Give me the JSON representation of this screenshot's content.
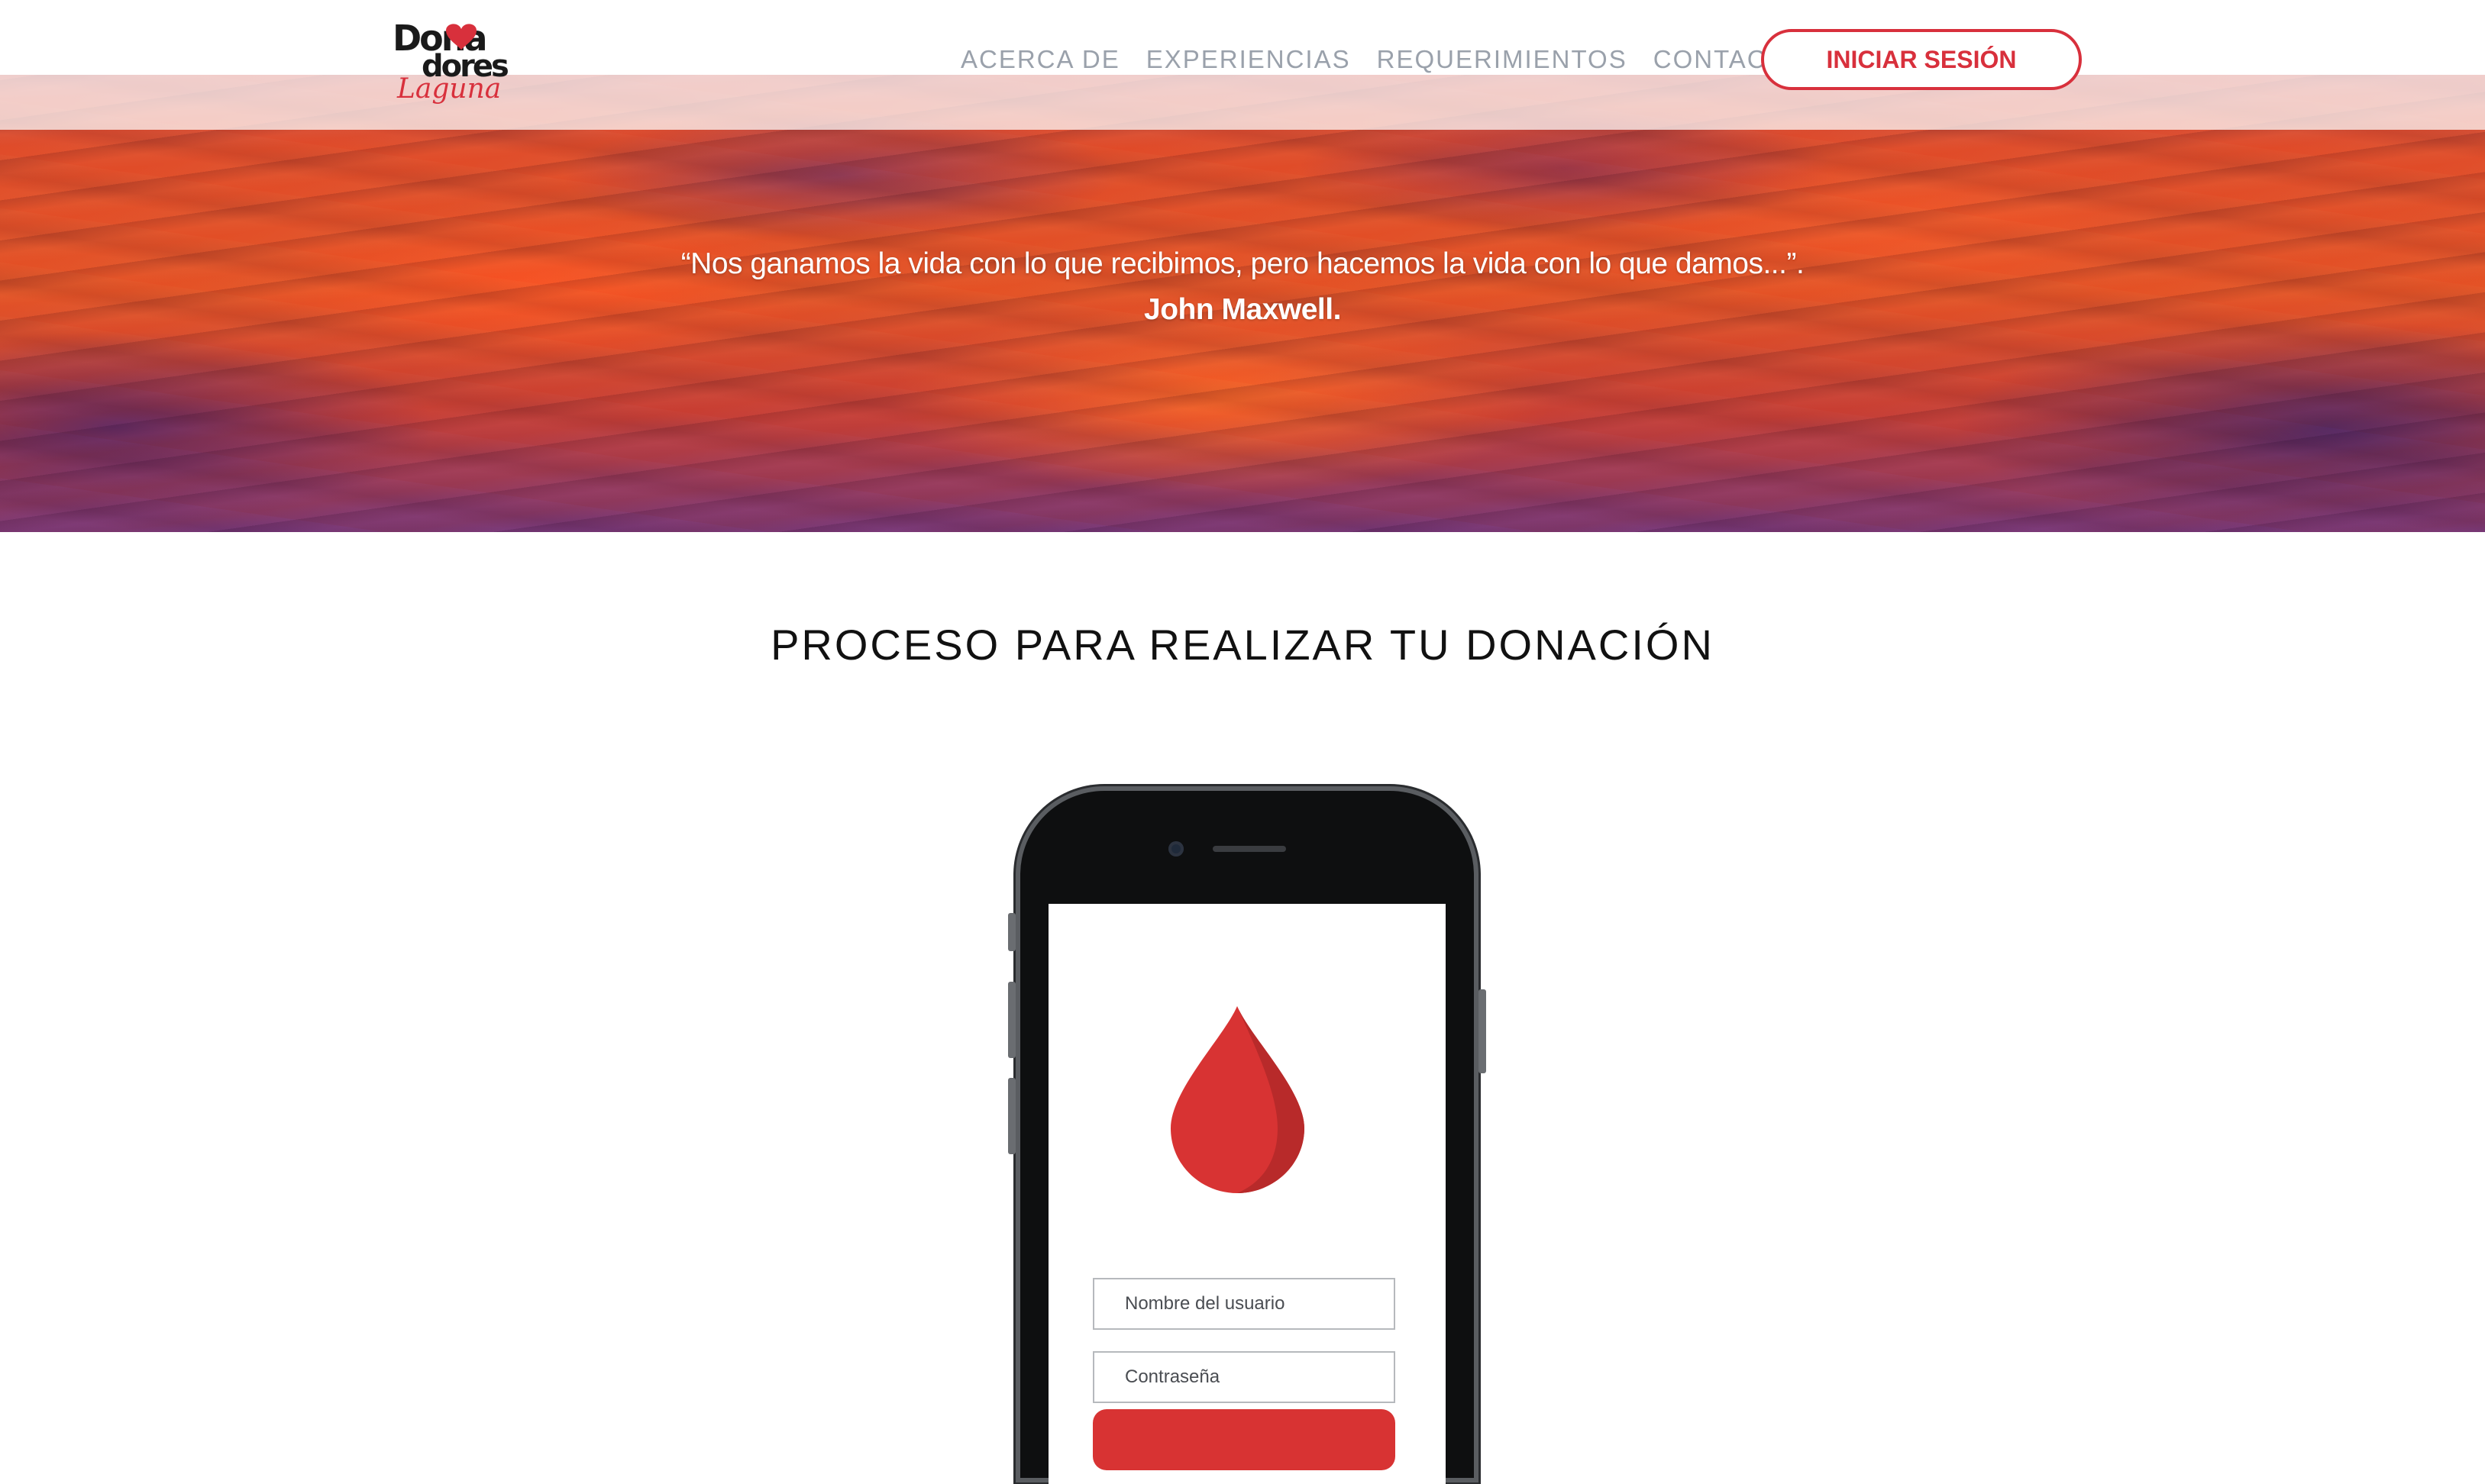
{
  "brand": {
    "logo_text_top": "Dona",
    "logo_text_mid": "dores",
    "logo_text_script": "Laguna",
    "accent_color": "#d8303c"
  },
  "nav": {
    "items": [
      {
        "label": "ACERCA DE"
      },
      {
        "label": "EXPERIENCIAS"
      },
      {
        "label": "REQUERIMIENTOS"
      },
      {
        "label": "CONTACTO"
      }
    ],
    "login_label": "INICIAR SESIÓN"
  },
  "hero": {
    "quote": "“Nos ganamos la vida con lo que recibimos, pero hacemos la vida con lo que damos...”.",
    "author": "John Maxwell."
  },
  "process": {
    "title": "PROCESO PARA REALIZAR TU DONACIÓN"
  },
  "phone_mockup": {
    "icon": "blood-drop-icon",
    "username_placeholder": "Nombre del usuario",
    "password_placeholder": "Contraseña",
    "drop_color": "#d83333"
  }
}
